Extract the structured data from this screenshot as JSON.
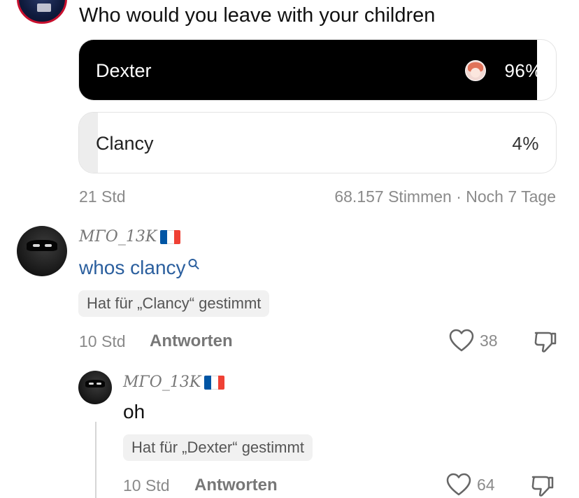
{
  "poll": {
    "question": "Who would you leave with your children",
    "options": [
      {
        "label": "Dexter",
        "percent": "96%",
        "fill": 0.96
      },
      {
        "label": "Clancy",
        "percent": "4%",
        "fill": 0.04
      }
    ],
    "posted": "21 Std",
    "votes_and_remaining": "68.157 Stimmen · Noch 7 Tage"
  },
  "comments": [
    {
      "username": "MΓO_13K",
      "text": "whos clancy",
      "vote_badge": "Hat für „Clancy“ gestimmt",
      "time": "10 Std",
      "reply_label": "Antworten",
      "likes": "38"
    },
    {
      "username": "MΓO_13K",
      "text": "oh",
      "vote_badge": "Hat für „Dexter“ gestimmt",
      "time": "10 Std",
      "reply_label": "Antworten",
      "likes": "64"
    }
  ],
  "colors": {
    "link": "#2b5f9e",
    "selected_option": "#000000",
    "muted_text": "#8a8a8a"
  }
}
